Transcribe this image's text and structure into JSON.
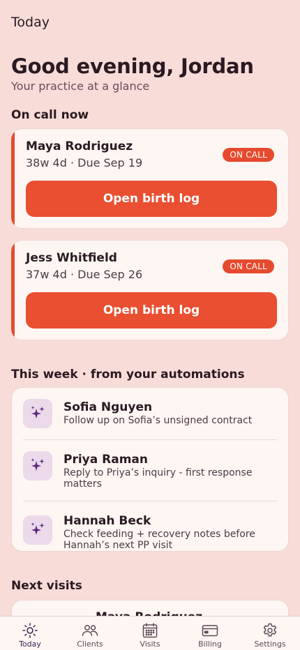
{
  "header": {
    "title": "Today"
  },
  "greeting": {
    "title": "Good evening, Jordan",
    "subtitle": "Your practice at a glance"
  },
  "on_call": {
    "section_title": "On call now",
    "clients": [
      {
        "name": "Maya Rodriguez",
        "meta": "38w 4d · Due Sep 19",
        "badge": "ON CALL",
        "button": "Open birth log"
      },
      {
        "name": "Jess Whitfield",
        "meta": "37w 4d · Due Sep 26",
        "badge": "ON CALL",
        "button": "Open birth log"
      }
    ]
  },
  "automations": {
    "section_title": "This week · from your automations",
    "icon": "sparkles-icon",
    "items": [
      {
        "name": "Sofia Nguyen",
        "desc": "Follow up on Sofia’s unsigned contract"
      },
      {
        "name": "Priya Raman",
        "desc": "Reply to Priya’s inquiry - first response matters"
      },
      {
        "name": "Hannah Beck",
        "desc": "Check feeding + recovery notes before Hannah’s next PP visit"
      }
    ]
  },
  "next_visits": {
    "section_title": "Next visits",
    "partial_name": "Maya Rodriguez"
  },
  "nav": {
    "items": [
      {
        "label": "Today",
        "icon": "sun-icon",
        "active": true
      },
      {
        "label": "Clients",
        "icon": "people-icon",
        "active": false
      },
      {
        "label": "Visits",
        "icon": "calendar-icon",
        "active": false
      },
      {
        "label": "Billing",
        "icon": "card-icon",
        "active": false
      },
      {
        "label": "Settings",
        "icon": "gear-icon",
        "active": false
      }
    ]
  },
  "colors": {
    "background": "#f8dcd7",
    "accent": "#e94f30",
    "icon_bg": "#ecd9ea",
    "icon_fg": "#5a2a82"
  }
}
